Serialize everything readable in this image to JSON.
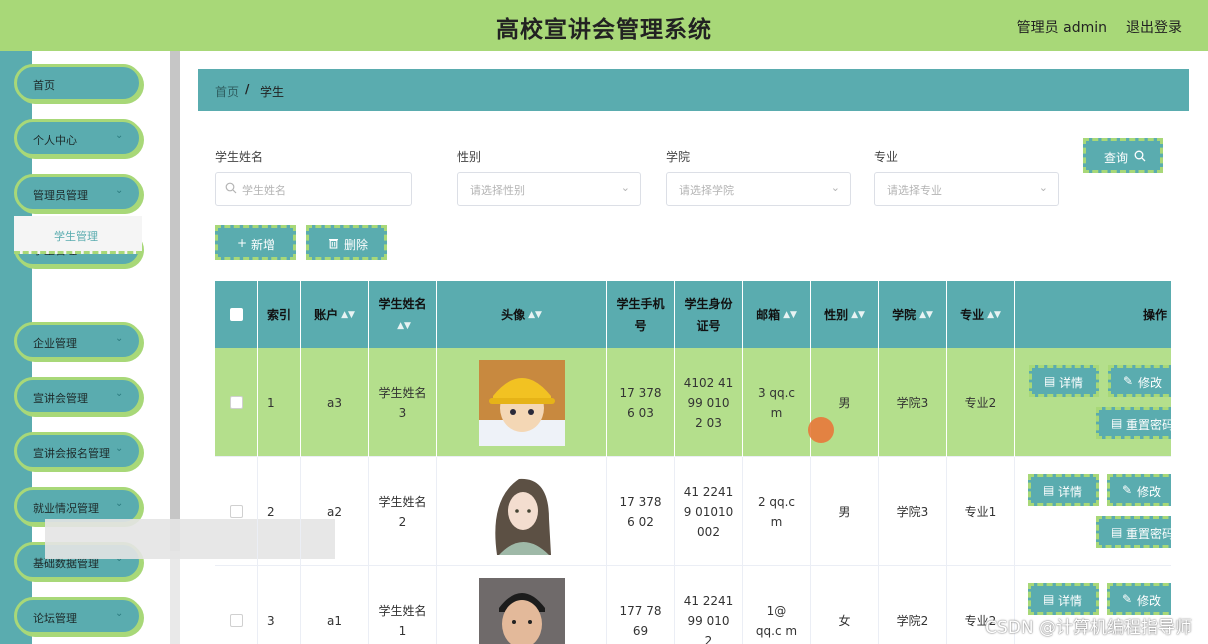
{
  "header": {
    "title": "高校宣讲会管理系统",
    "user": "管理员 admin",
    "logout": "退出登录"
  },
  "sidebar": {
    "items": [
      {
        "label": "首页"
      },
      {
        "label": "个人中心"
      },
      {
        "label": "管理员管理"
      },
      {
        "label": "学生管理"
      },
      {
        "label": "企业管理"
      },
      {
        "label": "宣讲会管理"
      },
      {
        "label": "宣讲会报名管理"
      },
      {
        "label": "就业情况管理"
      },
      {
        "label": "基础数据管理"
      },
      {
        "label": "论坛管理"
      }
    ],
    "submenu": {
      "label": "学生管理"
    }
  },
  "breadcrumb": {
    "home": "首页",
    "separator": "/",
    "current": "学生"
  },
  "filters": {
    "name_label": "学生姓名",
    "name_placeholder": "学生姓名",
    "gender_label": "性别",
    "gender_placeholder": "请选择性别",
    "college_label": "学院",
    "college_placeholder": "请选择学院",
    "major_label": "专业",
    "major_placeholder": "请选择专业",
    "query_label": "查询"
  },
  "actions": {
    "add_label": "新增",
    "delete_label": "删除"
  },
  "table": {
    "columns": {
      "index": "索引",
      "account": "账户",
      "name": "学生姓名",
      "avatar": "头像",
      "phone": "学生手机号",
      "idcard": "学生身份证号",
      "email": "邮箱",
      "gender": "性别",
      "college": "学院",
      "major": "专业",
      "ops": "操作"
    },
    "rows": [
      {
        "index": "1",
        "account": "a3",
        "name": "学生姓名3",
        "phone": "17 378 6 03",
        "idcard": "4102 41 99 010 2 03",
        "email": "3 qq.c m",
        "gender": "男",
        "college": "学院3",
        "major": "专业2"
      },
      {
        "index": "2",
        "account": "a2",
        "name": "学生姓名2",
        "phone": "17 378 6 02",
        "idcard": "41 2241 9 01010 002",
        "email": "2 qq.c m",
        "gender": "男",
        "college": "学院3",
        "major": "专业1"
      },
      {
        "index": "3",
        "account": "a1",
        "name": "学生姓名1",
        "phone": "177 78 69",
        "idcard": "41 2241 99 010 2",
        "email": "1@ qq.c m",
        "gender": "女",
        "college": "学院2",
        "major": "专业2"
      }
    ],
    "op_detail": "详情",
    "op_edit": "修改",
    "op_reset": "重置密码"
  },
  "watermark": "CSDN @计算机编程指导师",
  "colors": {
    "accent": "#5aacaf",
    "green": "#a8d878",
    "row_highlight": "#b4df8c"
  }
}
